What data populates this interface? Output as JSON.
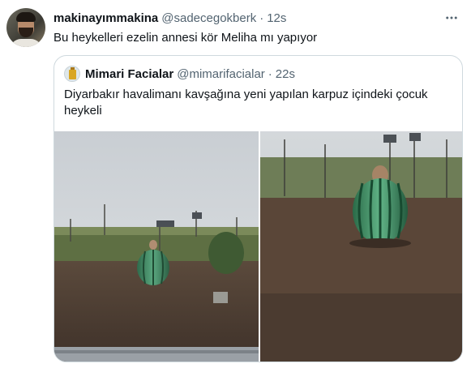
{
  "tweet": {
    "display_name": "makinayımmakina",
    "handle": "@sadecegokberk",
    "separator": "·",
    "time": "12s",
    "text": "Bu heykelleri ezelin annesi kör Meliha mı yapıyor"
  },
  "quote": {
    "display_name": "Mimari Facialar",
    "handle": "@mimarifacialar",
    "separator": "·",
    "time": "22s",
    "text": "Diyarbakır havalimanı kavşağına yeni yapılan karpuz içindeki çocuk heykeli"
  },
  "icons": {
    "more": "more-horizontal-icon"
  },
  "colors": {
    "secondary_text": "#536471",
    "primary_text": "#0f1419",
    "border": "#cfd9de"
  }
}
